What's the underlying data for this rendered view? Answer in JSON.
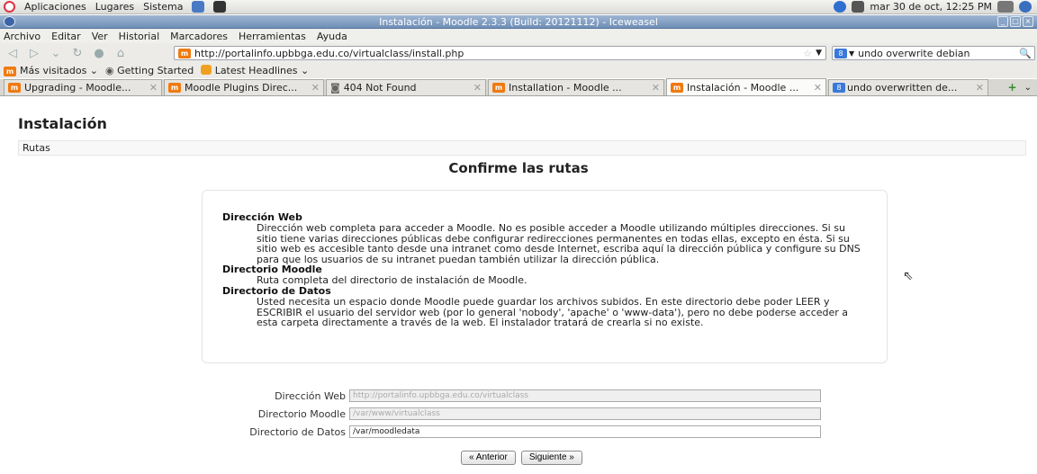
{
  "top_panel": {
    "menus": [
      "Aplicaciones",
      "Lugares",
      "Sistema"
    ],
    "clock": "mar 30 de oct, 12:25 PM"
  },
  "window": {
    "title": "Instalación - Moodle 2.3.3 (Build: 20121112) - Iceweasel"
  },
  "menubar": [
    "Archivo",
    "Editar",
    "Ver",
    "Historial",
    "Marcadores",
    "Herramientas",
    "Ayuda"
  ],
  "address": {
    "url": "http://portalinfo.upbbga.edu.co/virtualclass/install.php",
    "search_engine_badge": "8",
    "search_text": "undo overwrite debian"
  },
  "bookmarks": [
    "Más visitados",
    "Getting Started",
    "Latest Headlines"
  ],
  "tabs": [
    {
      "label": "Upgrading - Moodle...",
      "icon": "moodle-icon"
    },
    {
      "label": "Moodle Plugins Direc...",
      "icon": "moodle-icon"
    },
    {
      "label": "404 Not Found",
      "icon": "page-icon"
    },
    {
      "label": "Installation - Moodle ...",
      "icon": "moodle-icon"
    },
    {
      "label": "Instalación - Moodle ...",
      "icon": "moodle-icon"
    },
    {
      "label": "undo overwritten de...",
      "icon": "search-icon"
    }
  ],
  "page": {
    "heading": "Instalación",
    "nav_label": "Rutas",
    "confirm_title": "Confirme las rutas",
    "help": [
      {
        "term": "Dirección Web",
        "text": "Dirección web completa para acceder a Moodle. No es posible acceder a Moodle utilizando múltiples direcciones. Si su sitio tiene varias direcciones públicas debe configurar redirecciones permanentes en todas ellas, excepto en ésta. Si su sitio web es accesible tanto desde una intranet como desde Internet, escriba aquí la dirección pública y configure su DNS para que los usuarios de su intranet puedan también utilizar la dirección pública."
      },
      {
        "term": "Directorio Moodle",
        "text": "Ruta completa del directorio de instalación de Moodle."
      },
      {
        "term": "Directorio de Datos",
        "text": "Usted necesita un espacio donde Moodle puede guardar los archivos subidos. En este directorio debe poder LEER y ESCRIBIR el usuario del servidor web (por lo general 'nobody', 'apache' o 'www-data'), pero no debe poderse acceder a esta carpeta directamente a través de la web. El instalador tratará de crearla si no existe."
      }
    ],
    "fields": [
      {
        "label": "Dirección Web",
        "value": "http://portalinfo.upbbga.edu.co/virtualclass",
        "disabled": true
      },
      {
        "label": "Directorio Moodle",
        "value": "/var/www/virtualclass",
        "disabled": true
      },
      {
        "label": "Directorio de Datos",
        "value": "/var/moodledata",
        "disabled": false
      }
    ],
    "prev_button": "« Anterior",
    "next_button": "Siguiente »"
  }
}
